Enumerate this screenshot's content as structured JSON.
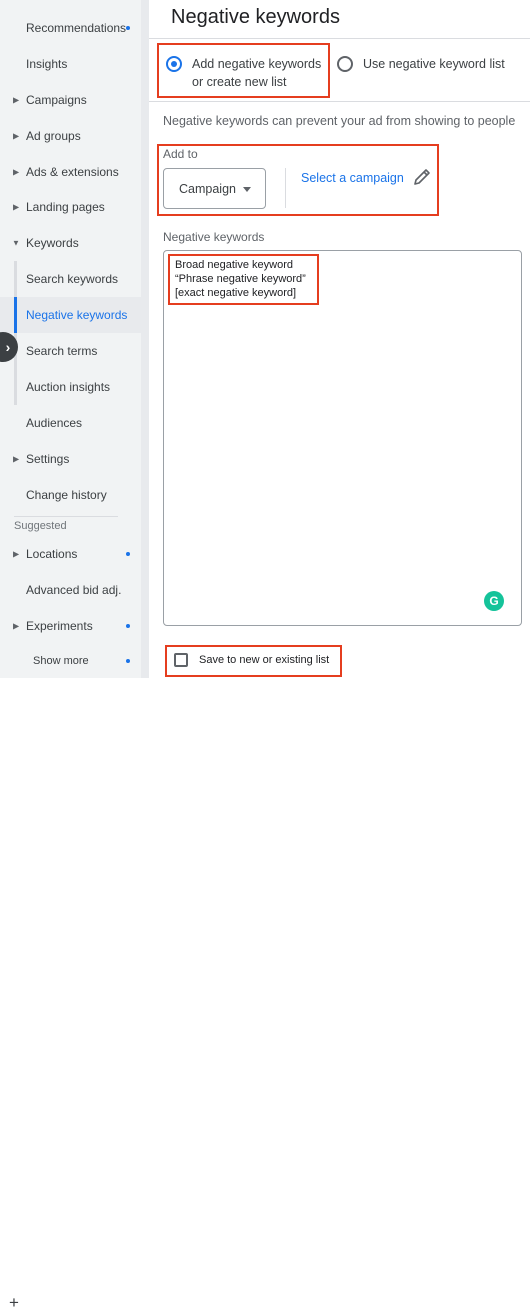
{
  "sidebar": {
    "items": [
      {
        "label": "Recommendations",
        "dot": true
      },
      {
        "label": "Insights"
      },
      {
        "label": "Campaigns",
        "caret": true
      },
      {
        "label": "Ad groups",
        "caret": true
      },
      {
        "label": "Ads & extensions",
        "caret": true
      },
      {
        "label": "Landing pages",
        "caret": true
      },
      {
        "label": "Keywords",
        "caret": true,
        "expanded": true
      },
      {
        "label": "Search keywords"
      },
      {
        "label": "Negative keywords",
        "active": true
      },
      {
        "label": "Search terms"
      },
      {
        "label": "Auction insights"
      },
      {
        "label": "Audiences"
      },
      {
        "label": "Settings",
        "caret": true
      },
      {
        "label": "Change history"
      }
    ],
    "suggested_label": "Suggested",
    "suggested": [
      {
        "label": "Locations",
        "caret": true,
        "dot": true
      },
      {
        "label": "Advanced bid adj."
      },
      {
        "label": "Experiments",
        "caret": true,
        "dot": true
      }
    ],
    "show_more": "Show more",
    "expand_icon": "chevron-right-icon"
  },
  "main": {
    "title": "Negative keywords",
    "options": [
      {
        "label": "Add negative keywords or create new list",
        "selected": true
      },
      {
        "label": "Use negative keyword list",
        "selected": false
      }
    ],
    "helper_text": "Negative keywords can prevent your ad from showing to people",
    "add_to_label": "Add to",
    "scope_dropdown": "Campaign",
    "select_link": "Select a campaign",
    "keywords_label": "Negative keywords",
    "keywords": [
      "Broad negative keyword",
      "“Phrase negative keyword”",
      "[exact negative keyword]"
    ],
    "grammarly_badge": "G",
    "save_checkbox_label": "Save to new or existing list",
    "save_checked": false
  },
  "colors": {
    "accent": "#1a73e8",
    "highlight": "#e53d1f",
    "sidebar_bg": "#f1f3f4"
  }
}
